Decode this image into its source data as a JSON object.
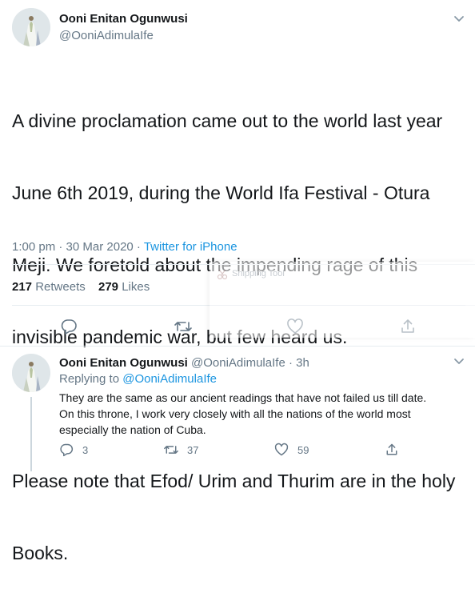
{
  "tweet": {
    "author_name": "Ooni Enitan Ogunwusi",
    "author_handle": "@OoniAdimulaIfe",
    "text_lines": [
      "A divine proclamation came out to the world last year",
      "June 6th 2019, during the World Ifa Festival - Otura",
      "Meji. We foretold about the impending rage of this",
      "invisible pandemic war, but few heard us.",
      "",
      "Please note that Efod/ Urim and Thurim are in the holy",
      "Books."
    ],
    "timestamp": "1:00 pm · 30 Mar 2020 · ",
    "source": "Twitter for iPhone",
    "retweets_count": "217",
    "retweets_label": "Retweets",
    "likes_count": "279",
    "likes_label": "Likes",
    "actions": [
      "reply-icon",
      "retweet-icon",
      "like-icon",
      "share-icon"
    ]
  },
  "overlay": {
    "title": "Snipping Tool"
  },
  "reply": {
    "author_name": "Ooni Enitan Ogunwusi",
    "author_handle": "@OoniAdimulaIfe",
    "time": "· 3h",
    "replying_prefix": "Replying to ",
    "replying_handle": "@OoniAdimulaIfe",
    "text_lines": [
      "They are the same as our ancient readings that have not failed us till date.",
      "On this throne, I work very closely with all the nations of the world most",
      "especially the nation of Cuba."
    ],
    "reply_count": "3",
    "retweet_count": "37",
    "like_count": "59"
  }
}
